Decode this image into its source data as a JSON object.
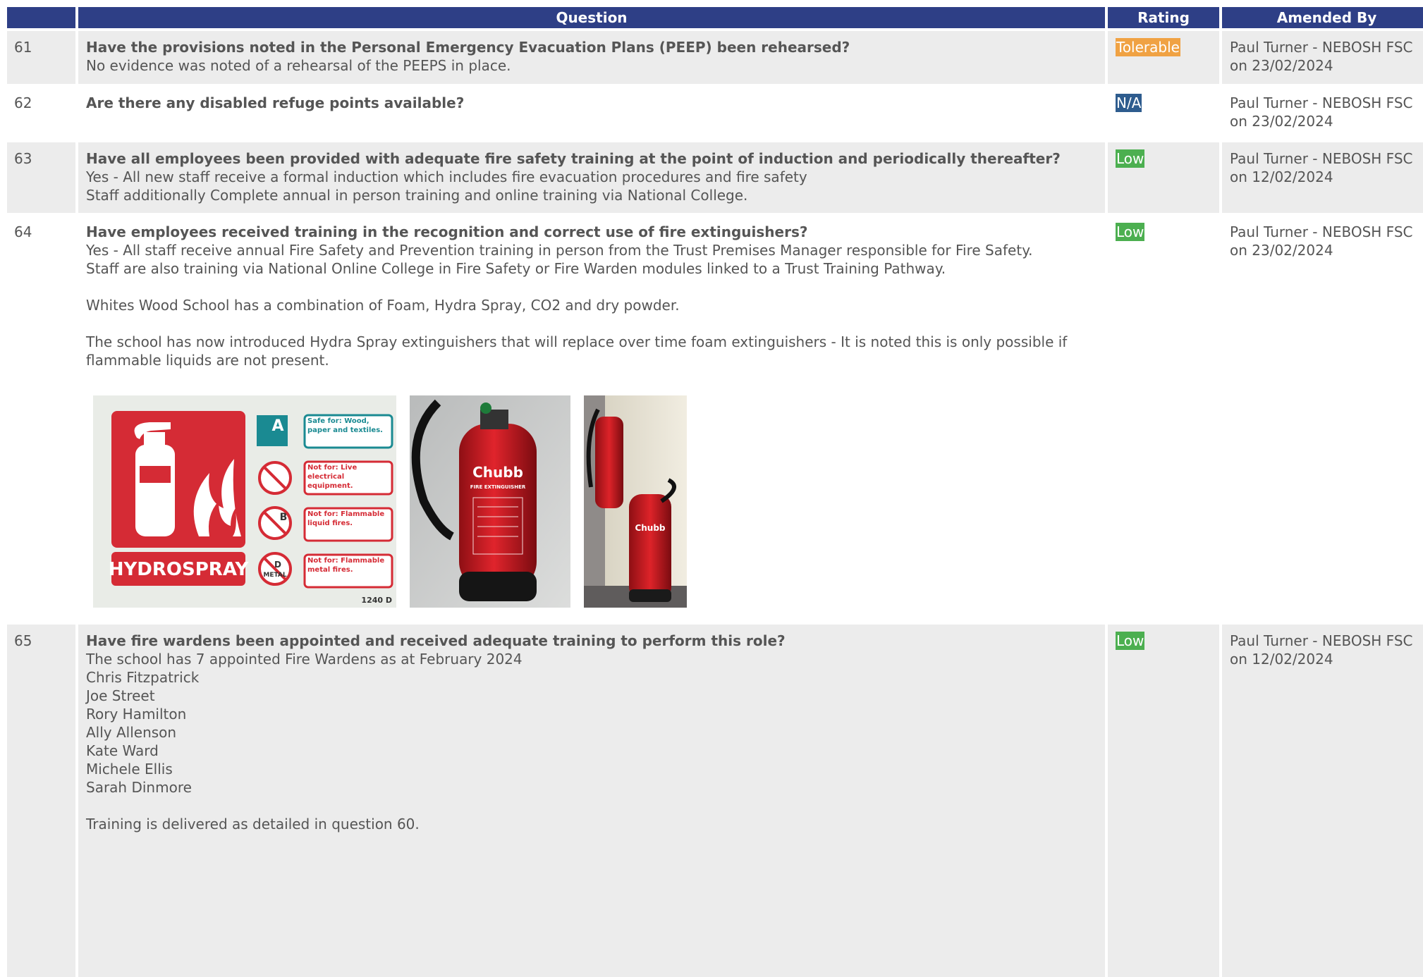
{
  "header": {
    "num": "",
    "question": "Question",
    "rating": "Rating",
    "amended": "Amended By"
  },
  "colors": {
    "header_bg": "#2e3f86",
    "tolerable": "#f0a243",
    "na": "#2e5c8e",
    "low": "#4caf50"
  },
  "rows": [
    {
      "num": "61",
      "question": "Have the provisions noted in the Personal Emergency Evacuation Plans (PEEP) been rehearsed?",
      "answer": "No evidence was noted of a rehearsal of the PEEPS in place.",
      "rating": "Tolerable",
      "amended_by": "Paul Turner - NEBOSH FSC",
      "amended_on": "on 23/02/2024"
    },
    {
      "num": "62",
      "question": "Are there any disabled refuge points available?",
      "answer": "",
      "rating": "N/A",
      "amended_by": "Paul Turner - NEBOSH FSC",
      "amended_on": "on 23/02/2024"
    },
    {
      "num": "63",
      "question": "Have all employees been provided with adequate fire safety training at the point of induction and periodically thereafter?",
      "answer": "Yes - All new staff receive a formal induction which includes fire evacuation procedures and fire safety\nStaff additionally Complete annual in person training and online training via National College.",
      "rating": "Low",
      "amended_by": "Paul Turner - NEBOSH FSC",
      "amended_on": "on 12/02/2024"
    },
    {
      "num": "64",
      "question": "Have employees received training in the recognition and correct use of fire extinguishers?",
      "answer": "Yes - All staff receive annual Fire Safety and Prevention training in person from the Trust Premises Manager responsible for Fire Safety.\nStaff are also training via National Online College in Fire Safety or Fire Warden modules linked to a Trust Training Pathway.\n\nWhites Wood School has a combination of Foam, Hydra Spray, CO2 and dry powder.\n\nThe school has now introduced Hydra Spray extinguishers that will replace over time foam extinguishers - It is noted this is only possible if flammable liquids are not present.",
      "rating": "Low",
      "amended_by": "Paul Turner - NEBOSH FSC",
      "amended_on": "on 23/02/2024",
      "images": {
        "sign": {
          "title": "HYDROSPRAY",
          "code": "1240 D",
          "labels": [
            "Safe for: Wood, paper and textiles.",
            "Not for: Live electrical equipment.",
            "Not for: Flammable liquid fires.",
            "Not for: Flammable metal fires."
          ],
          "letters": [
            "A",
            "B",
            "D"
          ],
          "metal": "METAL"
        },
        "photo1": {
          "brand": "Chubb",
          "sub": "FIRE EXTINGUISHER"
        },
        "photo2": {
          "brand": "Chubb"
        }
      }
    },
    {
      "num": "65",
      "question": "Have fire wardens been appointed and received adequate training to perform this role?",
      "answer": "The school has 7 appointed Fire Wardens as at February 2024\nChris Fitzpatrick\nJoe Street\nRory Hamilton\nAlly Allenson\nKate Ward\nMichele Ellis\nSarah Dinmore\n\nTraining is delivered as detailed in question 60.",
      "rating": "Low",
      "amended_by": "Paul Turner - NEBOSH FSC",
      "amended_on": "on 12/02/2024"
    }
  ]
}
